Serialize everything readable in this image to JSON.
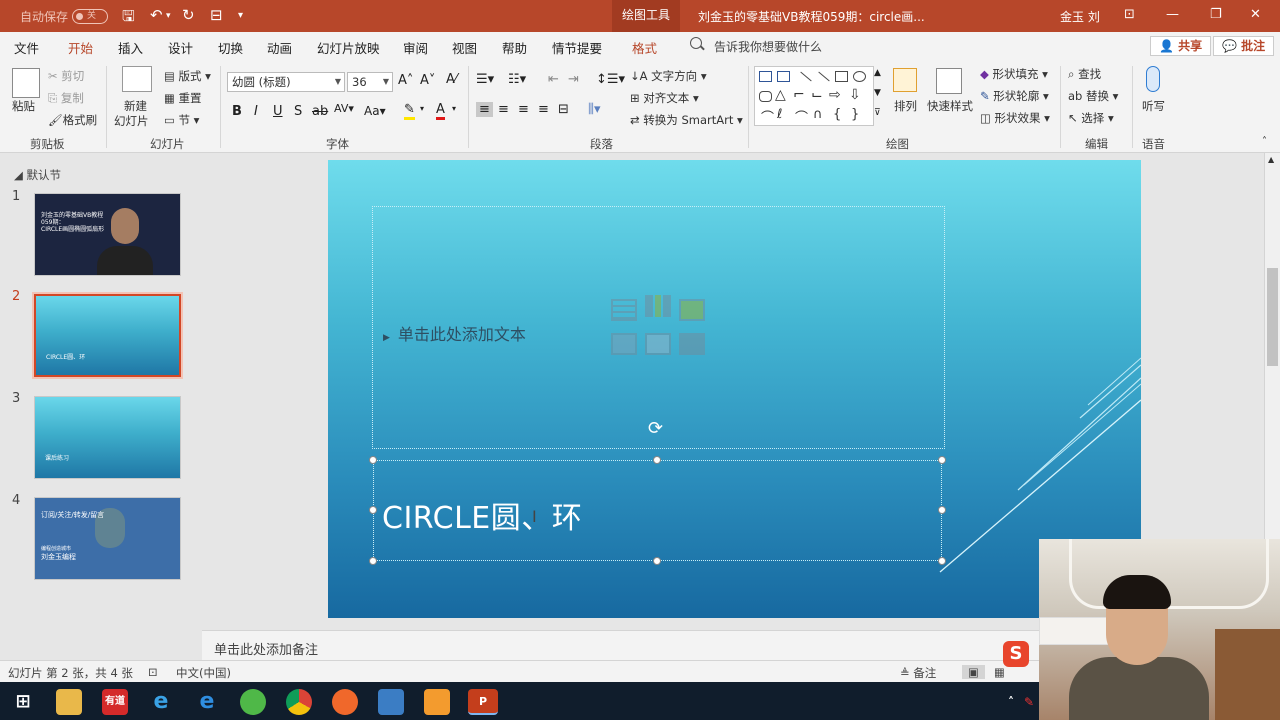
{
  "titlebar": {
    "autosave": "自动保存",
    "autosave_state": "关",
    "context_tab": "绘图工具",
    "doc_title": "刘金玉的零基础VB教程059期：circle画...",
    "user": "金玉 刘"
  },
  "tabs": [
    "文件",
    "开始",
    "插入",
    "设计",
    "切换",
    "动画",
    "幻灯片放映",
    "审阅",
    "视图",
    "帮助",
    "情节提要",
    "格式"
  ],
  "active_tab": "开始",
  "tellme": "告诉我你想要做什么",
  "share": "共享",
  "comments": "批注",
  "ribbon": {
    "clipboard": {
      "paste": "粘贴",
      "cut": "剪切",
      "copy": "复制",
      "format_painter": "格式刷",
      "label": "剪贴板"
    },
    "slides": {
      "new_slide": "新建",
      "new_slide2": "幻灯片",
      "layout": "版式",
      "reset": "重置",
      "section": "节",
      "label": "幻灯片"
    },
    "font": {
      "name": "幼圆 (标题)",
      "size": "36",
      "label": "字体"
    },
    "paragraph": {
      "text_direction": "文字方向",
      "align_text": "对齐文本",
      "smartart": "转换为 SmartArt",
      "label": "段落"
    },
    "drawing": {
      "arrange": "排列",
      "quick_styles": "快速样式",
      "fill": "形状填充",
      "outline": "形状轮廓",
      "effects": "形状效果",
      "label": "绘图"
    },
    "editing": {
      "find": "查找",
      "replace": "替换",
      "select": "选择",
      "label": "编辑"
    },
    "voice": {
      "dictate": "听写",
      "label": "语音"
    }
  },
  "left_pane": {
    "section": "默认节",
    "slides": [
      {
        "num": "1",
        "text": "刘金玉的零基础VB教程\n059期：\nCIRCLE画圆椭圆弧扇形"
      },
      {
        "num": "2",
        "text": "CIRCLE圆、环"
      },
      {
        "num": "3",
        "text": "课后练习"
      },
      {
        "num": "4",
        "text": "订阅/关注/转发/留言",
        "sub": "刘金玉编程",
        "sub0": "编程创造城市"
      }
    ]
  },
  "slide": {
    "content_placeholder": "单击此处添加文本",
    "title": "CIRCLE圆、环"
  },
  "notes_placeholder": "单击此处添加备注",
  "status": {
    "slide_info": "幻灯片 第 2 张，共 4 张",
    "language": "中文(中国)",
    "notes_btn": "备注"
  },
  "colors": {
    "accent": "#b7472a",
    "taskbar": "#101d2c"
  }
}
